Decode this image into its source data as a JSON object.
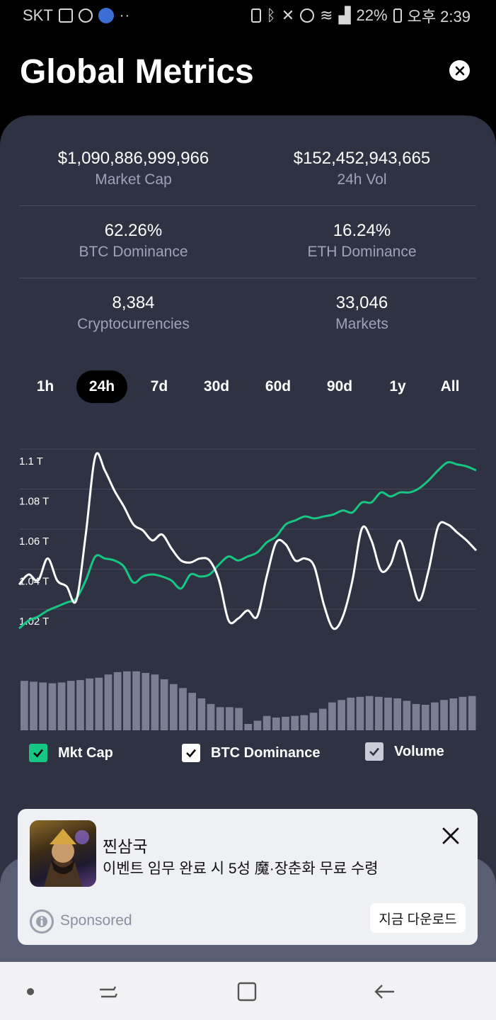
{
  "status_bar": {
    "carrier": "SKT",
    "battery": "22%",
    "time": "오후 2:39",
    "icons": [
      "gallery-icon",
      "shield-icon",
      "weather-icon",
      "more-dots-icon",
      "battery-saver-icon",
      "bluetooth-icon",
      "mute-icon",
      "alarm-icon",
      "wifi-icon",
      "signal-icon",
      "battery-icon"
    ]
  },
  "header": {
    "title": "Global Metrics",
    "close_icon": "close-icon"
  },
  "metrics": [
    [
      {
        "value": "$1,090,886,999,966",
        "label": "Market Cap"
      },
      {
        "value": "$152,452,943,665",
        "label": "24h Vol"
      }
    ],
    [
      {
        "value": "62.26%",
        "label": "BTC Dominance"
      },
      {
        "value": "16.24%",
        "label": "ETH Dominance"
      }
    ],
    [
      {
        "value": "8,384",
        "label": "Cryptocurrencies"
      },
      {
        "value": "33,046",
        "label": "Markets"
      }
    ]
  ],
  "tabs": [
    {
      "label": "1h",
      "active": false
    },
    {
      "label": "24h",
      "active": true
    },
    {
      "label": "7d",
      "active": false
    },
    {
      "label": "30d",
      "active": false
    },
    {
      "label": "60d",
      "active": false
    },
    {
      "label": "90d",
      "active": false
    },
    {
      "label": "1y",
      "active": false
    },
    {
      "label": "All",
      "active": false
    }
  ],
  "chart_data": {
    "type": "line",
    "y_ticks": [
      "1.1 T",
      "1.08 T",
      "1.06 T",
      "1.04 T",
      "1.02 T"
    ],
    "y_tick_values": [
      1.1,
      1.08,
      1.06,
      1.04,
      1.02
    ],
    "ylim": [
      1.014,
      1.106
    ],
    "grid": true,
    "x": [
      0,
      1,
      2,
      3,
      4,
      5,
      6,
      7,
      8,
      9,
      10,
      11,
      12,
      13,
      14,
      15,
      16,
      17,
      18,
      19,
      20,
      21,
      22,
      23,
      24,
      25,
      26,
      27,
      28,
      29,
      30,
      31,
      32,
      33,
      34,
      35,
      36,
      37,
      38,
      39,
      40,
      41,
      42,
      43,
      44,
      45,
      46,
      47,
      48
    ],
    "series": [
      {
        "name": "Mkt Cap",
        "color": "#ffffff",
        "values": [
          1.038,
          1.043,
          1.04,
          1.051,
          1.04,
          1.037,
          1.03,
          1.063,
          1.102,
          1.095,
          1.085,
          1.077,
          1.068,
          1.065,
          1.06,
          1.063,
          1.056,
          1.05,
          1.049,
          1.051,
          1.05,
          1.04,
          1.02,
          1.021,
          1.025,
          1.022,
          1.042,
          1.059,
          1.058,
          1.05,
          1.051,
          1.047,
          1.028,
          1.016,
          1.022,
          1.04,
          1.066,
          1.06,
          1.045,
          1.048,
          1.06,
          1.045,
          1.03,
          1.045,
          1.067,
          1.068,
          1.064,
          1.06,
          1.055
        ]
      },
      {
        "name": "BTC Dominance",
        "color": "#16c784",
        "values": [
          1.016,
          1.02,
          1.022,
          1.025,
          1.027,
          1.029,
          1.031,
          1.04,
          1.052,
          1.051,
          1.05,
          1.047,
          1.039,
          1.042,
          1.043,
          1.042,
          1.04,
          1.036,
          1.043,
          1.042,
          1.043,
          1.048,
          1.052,
          1.05,
          1.052,
          1.054,
          1.059,
          1.062,
          1.068,
          1.07,
          1.072,
          1.071,
          1.072,
          1.073,
          1.075,
          1.074,
          1.079,
          1.079,
          1.084,
          1.082,
          1.084,
          1.084,
          1.086,
          1.09,
          1.095,
          1.099,
          1.098,
          1.097,
          1.095
        ]
      }
    ],
    "volume": {
      "name": "Volume",
      "values": [
        62,
        61,
        60,
        59,
        60,
        62,
        63,
        65,
        66,
        70,
        73,
        74,
        74,
        72,
        70,
        64,
        58,
        53,
        47,
        40,
        33,
        29,
        29,
        28,
        8,
        12,
        18,
        16,
        17,
        18,
        19,
        22,
        27,
        35,
        38,
        41,
        42,
        43,
        42,
        41,
        40,
        37,
        33,
        32,
        35,
        38,
        40,
        42,
        43
      ]
    }
  },
  "legend": [
    {
      "label": "Mkt Cap",
      "color": "#16c784",
      "checked": true
    },
    {
      "label": "BTC Dominance",
      "color": "#ffffff",
      "checked": true
    },
    {
      "label": "Volume",
      "color": "#c9ccd6",
      "checked": true
    }
  ],
  "ad": {
    "title": "찐삼국",
    "description": "이벤트 임무 완료 시 5성 魔·장춘화 무료 수령",
    "sponsored": "Sponsored",
    "cta": "지금 다운로드"
  },
  "nav": {
    "items": [
      "dot-icon",
      "recent-apps-icon",
      "home-icon",
      "back-icon"
    ]
  }
}
